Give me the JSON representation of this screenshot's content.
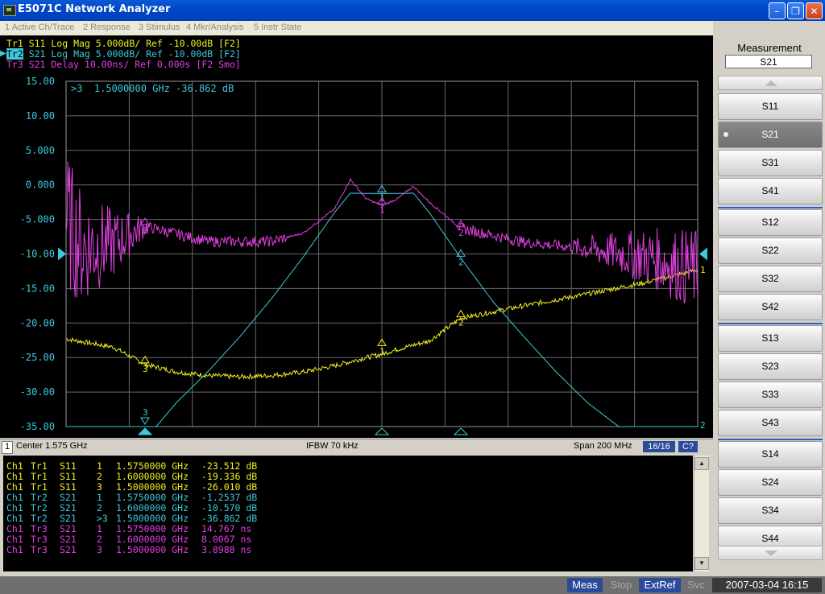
{
  "window": {
    "title": "E5071C Network Analyzer",
    "minimize_icon": "minimize-icon",
    "maximize_icon": "restore-icon",
    "close_icon": "close-icon"
  },
  "menu": [
    "1 Active Ch/Trace",
    "2 Response",
    "3 Stimulus",
    "4 Mkr/Analysis",
    "5 Instr State"
  ],
  "trace_legend": [
    {
      "text": "Tr1 S11 Log Mag 5.000dB/ Ref -10.00dB [F2]",
      "color": "#f0f020"
    },
    {
      "text": "Tr2 S21 Log Mag 5.000dB/ Ref -10.00dB [F2]",
      "color": "#3ec8d8"
    },
    {
      "text": "Tr3 S21 Delay 10.00ns/ Ref 0.000s [F2 Smo]",
      "color": "#e040e0"
    }
  ],
  "active_marker_readout": ">3  1.5000000 GHz -36.862 dB",
  "y_ticks": [
    "15.00",
    "10.00",
    "5.000",
    "0.000",
    "-5.000",
    "-10.00",
    "-15.00",
    "-20.00",
    "-25.00",
    "-30.00",
    "-35.00"
  ],
  "colors": {
    "tr1": "#f0f020",
    "tr2": "#3ec8d8",
    "tr3": "#e040e0",
    "grid": "#6a6a6a"
  },
  "marker_labels": {
    "tr1": [
      "1",
      "2",
      "3"
    ],
    "tr2": [
      "1",
      "2",
      "3"
    ],
    "tr3": [
      "1",
      "2",
      "3"
    ],
    "tr1_end": "1",
    "tr2_end": "2"
  },
  "chart_data": {
    "type": "line",
    "ylabel": "",
    "ylim": [
      -35,
      15
    ],
    "xlim_ghz": [
      1.475,
      1.675
    ],
    "series": [
      {
        "key": "tr1",
        "x": [
          1.475,
          1.49,
          1.5,
          1.51,
          1.52,
          1.53,
          1.54,
          1.55,
          1.56,
          1.57,
          1.575,
          1.58,
          1.59,
          1.6,
          1.62,
          1.64,
          1.66,
          1.675
        ],
        "y": [
          -22.3,
          -23.5,
          -26.0,
          -27.1,
          -27.6,
          -27.8,
          -27.6,
          -27.1,
          -26.2,
          -25.0,
          -24.5,
          -23.8,
          -22.6,
          -19.3,
          -17.5,
          -15.8,
          -14.0,
          -12.3
        ]
      },
      {
        "key": "tr2",
        "x": [
          1.475,
          1.49,
          1.5,
          1.51,
          1.52,
          1.53,
          1.54,
          1.55,
          1.56,
          1.565,
          1.575,
          1.585,
          1.59,
          1.6,
          1.61,
          1.62,
          1.63,
          1.64,
          1.65,
          1.66,
          1.675
        ],
        "y": [
          -35,
          -35,
          -36.9,
          -31.5,
          -27.0,
          -22.0,
          -16.5,
          -10.5,
          -4.0,
          -1.2,
          -1.25,
          -1.2,
          -4.0,
          -10.6,
          -16.8,
          -22.0,
          -27.0,
          -31.5,
          -35,
          -35,
          -35
        ]
      },
      {
        "key": "tr3",
        "x": [
          1.475,
          1.48,
          1.49,
          1.5,
          1.52,
          1.54,
          1.55,
          1.56,
          1.565,
          1.57,
          1.575,
          1.58,
          1.585,
          1.59,
          1.6,
          1.62,
          1.64,
          1.66,
          1.675
        ],
        "y": [
          -5,
          -9,
          -8.5,
          -6.0,
          -8.2,
          -8.2,
          -7.0,
          -3.5,
          0.8,
          -2.0,
          -3.0,
          -2.0,
          -0.2,
          -2.5,
          -6.3,
          -8.3,
          -9.2,
          -10.5,
          -12.5
        ]
      }
    ],
    "markers": [
      {
        "trace": "tr1",
        "label": "1",
        "x": 1.575,
        "y": -23.512
      },
      {
        "trace": "tr1",
        "label": "2",
        "x": 1.6,
        "y": -19.336
      },
      {
        "trace": "tr1",
        "label": "3",
        "x": 1.5,
        "y": -26.01
      },
      {
        "trace": "tr2",
        "label": "1",
        "x": 1.575,
        "y": -1.2537
      },
      {
        "trace": "tr2",
        "label": "2",
        "x": 1.6,
        "y": -10.57
      },
      {
        "trace": "tr2",
        "label": "3",
        "x": 1.5,
        "y": -36.862
      },
      {
        "trace": "tr3",
        "label": "1",
        "x": 1.575,
        "y": -3.0
      },
      {
        "trace": "tr3",
        "label": "2",
        "x": 1.6,
        "y": -6.3
      },
      {
        "trace": "tr3",
        "label": "3",
        "x": 1.5,
        "y": -6.0
      }
    ]
  },
  "status": {
    "channel": "1",
    "center": "Center 1.575 GHz",
    "ifbw": "IFBW 70 kHz",
    "span": "Span 200 MHz",
    "count": "16/16",
    "cal": "C?"
  },
  "marker_table": [
    {
      "ch": "Ch1",
      "tr": "Tr1",
      "param": "S11",
      "mk": "1",
      "freq": "1.5750000 GHz",
      "val": "-23.512 dB"
    },
    {
      "ch": "Ch1",
      "tr": "Tr1",
      "param": "S11",
      "mk": "2",
      "freq": "1.6000000 GHz",
      "val": "-19.336 dB"
    },
    {
      "ch": "Ch1",
      "tr": "Tr1",
      "param": "S11",
      "mk": "3",
      "freq": "1.5000000 GHz",
      "val": "-26.010 dB"
    },
    {
      "ch": "Ch1",
      "tr": "Tr2",
      "param": "S21",
      "mk": "1",
      "freq": "1.5750000 GHz",
      "val": "-1.2537 dB"
    },
    {
      "ch": "Ch1",
      "tr": "Tr2",
      "param": "S21",
      "mk": "2",
      "freq": "1.6000000 GHz",
      "val": "-10.570 dB"
    },
    {
      "ch": "Ch1",
      "tr": "Tr2",
      "param": "S21",
      "mk": ">3",
      "freq": "1.5000000 GHz",
      "val": "-36.862 dB"
    },
    {
      "ch": "Ch1",
      "tr": "Tr3",
      "param": "S21",
      "mk": "1",
      "freq": "1.5750000 GHz",
      "val": "14.767 ns"
    },
    {
      "ch": "Ch1",
      "tr": "Tr3",
      "param": "S21",
      "mk": "2",
      "freq": "1.6000000 GHz",
      "val": "8.0067 ns"
    },
    {
      "ch": "Ch1",
      "tr": "Tr3",
      "param": "S21",
      "mk": "3",
      "freq": "1.5000000 GHz",
      "val": "3.8988 ns"
    }
  ],
  "softkeys": {
    "title": "Measurement",
    "current": "S21",
    "items": [
      "S11",
      "S21",
      "S31",
      "S41",
      "S12",
      "S22",
      "S32",
      "S42",
      "S13",
      "S23",
      "S33",
      "S43",
      "S14",
      "S24",
      "S34",
      "S44"
    ],
    "selected": "S21"
  },
  "bottom": {
    "meas": "Meas",
    "stop": "Stop",
    "extref": "ExtRef",
    "svc": "Svc",
    "datetime": "2007-03-04 16:15"
  }
}
